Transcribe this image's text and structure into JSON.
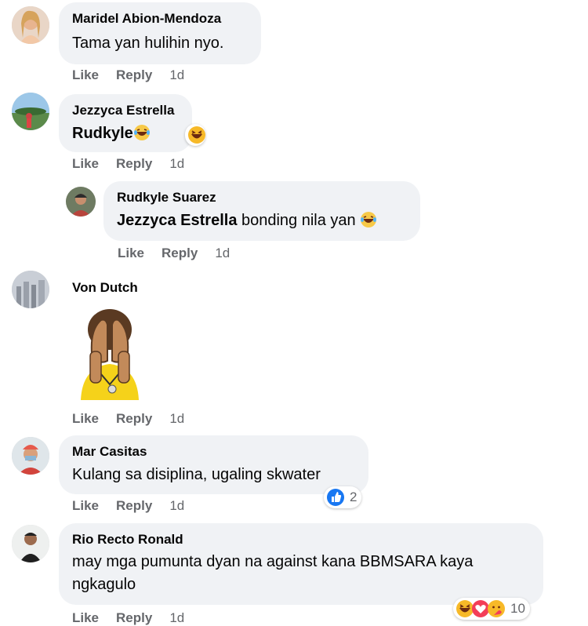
{
  "actions": {
    "like": "Like",
    "reply": "Reply"
  },
  "comments": [
    {
      "author": "Maridel Abion-Mendoza",
      "text": "Tama yan hulihin nyo.",
      "time": "1d"
    },
    {
      "author": "Jezzyca Estrella",
      "text": "Rudkyle",
      "time": "1d"
    },
    {
      "author": "Rudkyle Suarez",
      "mention": "Jezzyca Estrella",
      "text": " bonding nila yan ",
      "time": "1d"
    },
    {
      "author": "Von Dutch",
      "sticker": "face-palm-sticker",
      "time": "1d"
    },
    {
      "author": "Mar Casitas",
      "text": "Kulang sa disiplina, ugaling skwater",
      "time": "1d",
      "reactions": "2"
    },
    {
      "author": "Rio Recto Ronald",
      "text_line1": "may mga pumunta dyan na against kana BBMSARA kaya",
      "text_line2": "ngkagulo",
      "time": "1d",
      "reactions": "10"
    }
  ],
  "colors": {
    "bubble": "#f0f2f5",
    "action": "#65676b",
    "like_blue": "#1877f2"
  }
}
